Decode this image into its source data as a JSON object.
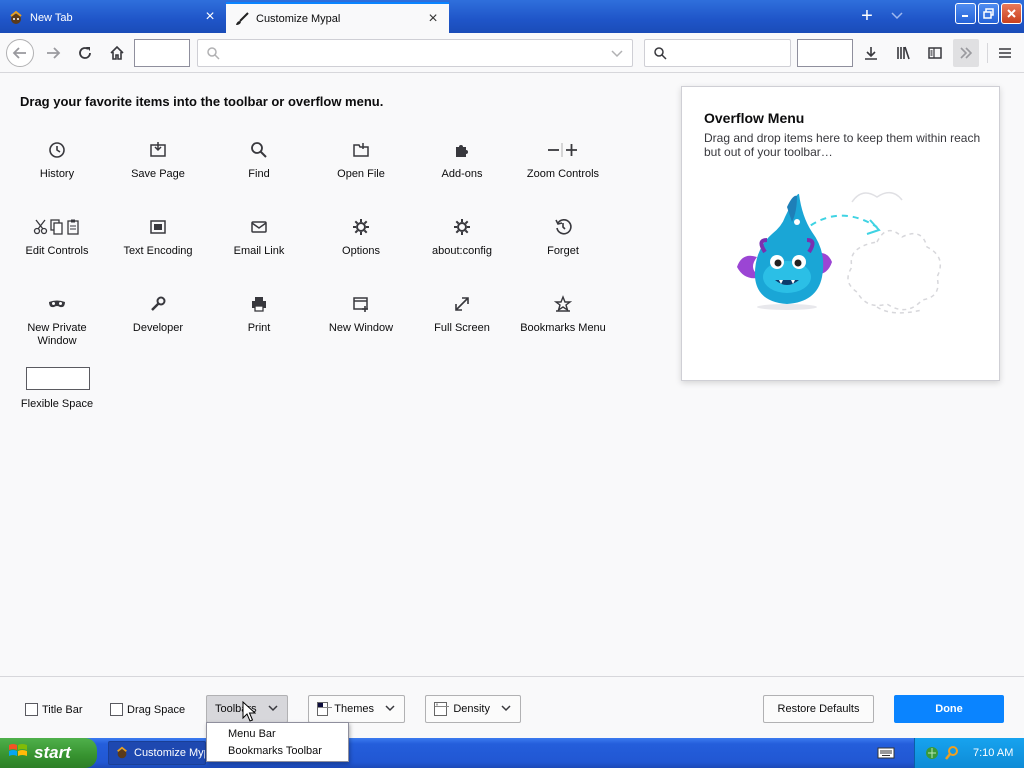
{
  "tabs": [
    {
      "label": "New Tab"
    },
    {
      "label": "Customize Mypal"
    }
  ],
  "palette": {
    "heading": "Drag your favorite items into the toolbar or overflow menu.",
    "items": [
      {
        "label": "History",
        "icon": "clock-icon"
      },
      {
        "label": "Save Page",
        "icon": "save-page-icon"
      },
      {
        "label": "Find",
        "icon": "magnifier-icon"
      },
      {
        "label": "Open File",
        "icon": "folder-icon"
      },
      {
        "label": "Add-ons",
        "icon": "puzzle-icon"
      },
      {
        "label": "Zoom Controls",
        "icon": "zoom-icon"
      },
      {
        "label": "Edit Controls",
        "icon": "edit-icon"
      },
      {
        "label": "Text Encoding",
        "icon": "encoding-icon"
      },
      {
        "label": "Email Link",
        "icon": "envelope-icon"
      },
      {
        "label": "Options",
        "icon": "gear-icon"
      },
      {
        "label": "about:config",
        "icon": "gear-icon"
      },
      {
        "label": "Forget",
        "icon": "forget-icon"
      },
      {
        "label": "New Private Window",
        "icon": "mask-icon"
      },
      {
        "label": "Developer",
        "icon": "wrench-icon"
      },
      {
        "label": "Print",
        "icon": "printer-icon"
      },
      {
        "label": "New Window",
        "icon": "new-window-icon"
      },
      {
        "label": "Full Screen",
        "icon": "fullscreen-icon"
      },
      {
        "label": "Bookmarks Menu",
        "icon": "bookmarks-icon"
      }
    ],
    "flexible_space": "Flexible Space"
  },
  "overflow": {
    "title": "Overflow Menu",
    "description": "Drag and drop items here to keep them within reach but out of your toolbar…"
  },
  "footer": {
    "title_bar": "Title Bar",
    "drag_space": "Drag Space",
    "toolbars": "Toolbars",
    "themes": "Themes",
    "density": "Density",
    "restore": "Restore Defaults",
    "done": "Done"
  },
  "toolbars_menu": {
    "items": [
      "Menu Bar",
      "Bookmarks Toolbar"
    ]
  },
  "taskbar": {
    "start": "start",
    "task": "Customize Mypal",
    "clock": "7:10 AM"
  },
  "colors": {
    "accent": "#0a84ff",
    "titlebar": "#245edb",
    "start": "#36922f"
  }
}
